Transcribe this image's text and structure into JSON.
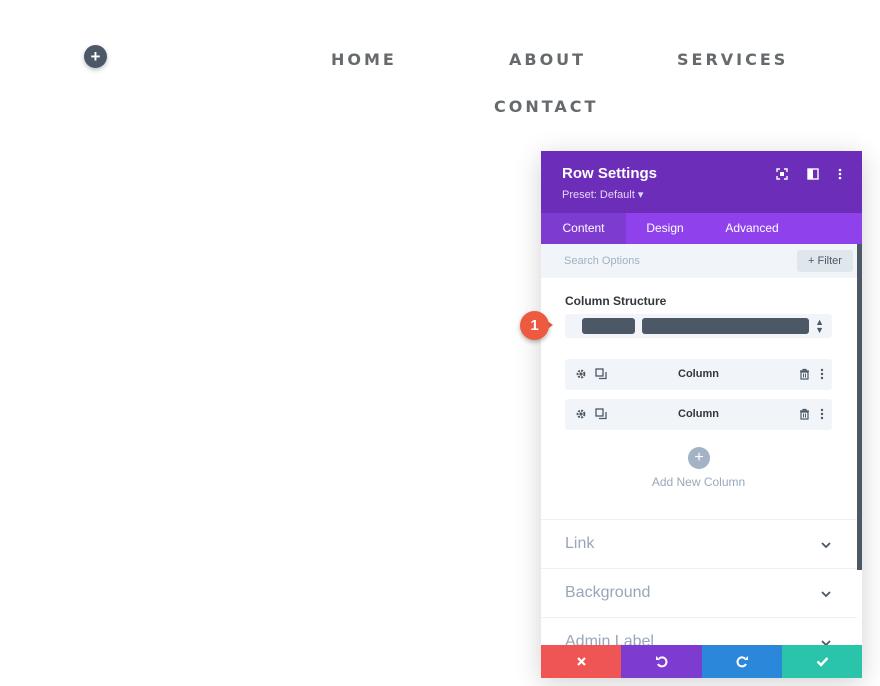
{
  "page": {
    "add_section_symbol": "+",
    "nav": [
      "HOME",
      "ABOUT",
      "SERVICES",
      "CONTACT"
    ]
  },
  "panel": {
    "title": "Row Settings",
    "preset": "Preset: Default ▾",
    "header_icons": [
      "fullscreen-icon",
      "split-view-icon",
      "more-options-icon"
    ],
    "tabs": [
      "Content",
      "Design",
      "Advanced"
    ],
    "active_tab": "Content",
    "search_placeholder": "Search Options",
    "filter_label": "+ Filter",
    "column_structure_label": "Column Structure",
    "columns": [
      {
        "label": "Column"
      },
      {
        "label": "Column"
      }
    ],
    "add_column_symbol": "+",
    "add_column_label": "Add New Column",
    "toggles": [
      "Link",
      "Background",
      "Admin Label"
    ],
    "footer_buttons": [
      "discard-icon",
      "undo-icon",
      "redo-icon",
      "save-check-icon"
    ]
  },
  "annotation": {
    "number": "1"
  },
  "colors": {
    "header": "#6c2eb9",
    "tabs": "#8f42ec",
    "tab_active": "#7e3bd0",
    "discard": "#ef5555",
    "undo": "#7e3bd0",
    "redo": "#2b87da",
    "save": "#29c4a9",
    "badge": "#ee5a40"
  }
}
